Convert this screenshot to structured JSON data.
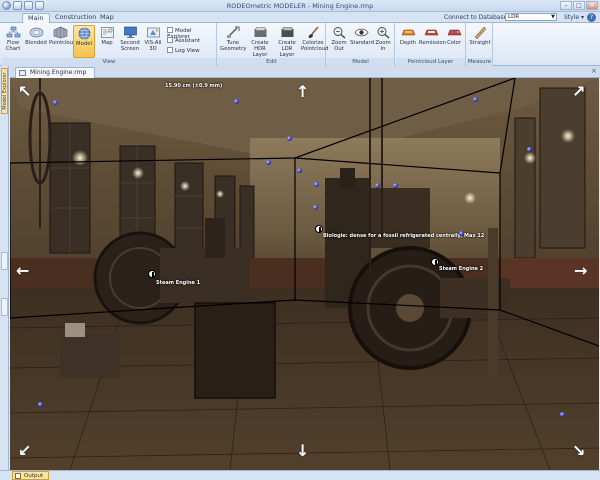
{
  "app": {
    "title": "RODEOmetric MODELER - Mining Engine.rmp"
  },
  "window": {
    "minimize": "–",
    "maximize": "□",
    "close": "✕"
  },
  "ribbon_tabs": [
    "Main",
    "Construction",
    "Map"
  ],
  "top_right": {
    "connect": "Connect to Database...",
    "select_value": "LDR",
    "style": "Style ▾",
    "help": "?"
  },
  "ribbon": {
    "view": {
      "caption": "View",
      "buttons": [
        {
          "label": "Flow\nChart",
          "icon": "flow-chart-icon"
        },
        {
          "label": "Blended",
          "icon": "blended-icon"
        },
        {
          "label": "Pointcloud",
          "icon": "pointcloud-icon"
        },
        {
          "label": "Model",
          "icon": "globe-icon",
          "active": true
        },
        {
          "label": "Map",
          "icon": "map-icon"
        },
        {
          "label": "Second\nScreen",
          "icon": "monitor-icon"
        },
        {
          "label": "VIS-All\n3D",
          "icon": "vis-3d-icon"
        }
      ],
      "checkboxes": [
        "Model Explorer",
        "Assistant",
        "Log View"
      ]
    },
    "edit": {
      "caption": "Edit",
      "buttons": [
        {
          "label": "Tune\nGeometry",
          "icon": "tune-geometry-icon"
        },
        {
          "label": "Create\nHDR Layer",
          "icon": "hdr-layer-icon"
        },
        {
          "label": "Create\nLDR Layer",
          "icon": "ldr-layer-icon"
        },
        {
          "label": "Colorize\nPointcloud",
          "icon": "brush-icon"
        }
      ]
    },
    "model": {
      "caption": "Model",
      "buttons": [
        {
          "label": "Zoom\nOut",
          "icon": "zoom-out-icon"
        },
        {
          "label": "Standard",
          "icon": "eye-icon"
        },
        {
          "label": "Zoom\nIn",
          "icon": "zoom-in-icon"
        }
      ]
    },
    "pointcloud_layer": {
      "caption": "Pointcloud Layer",
      "buttons": [
        {
          "label": "Depth",
          "icon": "depth-icon"
        },
        {
          "label": "Remission",
          "icon": "remission-icon"
        },
        {
          "label": "Color",
          "icon": "color-icon"
        }
      ]
    },
    "measure": {
      "caption": "Measure",
      "buttons": [
        {
          "label": "Straight",
          "icon": "ruler-icon"
        }
      ]
    }
  },
  "left_panel": {
    "tab_label": "Model Explorer"
  },
  "document": {
    "tab_label": "Mining Engine.rmp",
    "close": "×"
  },
  "scene": {
    "measurement_label": "15.90 cm (±0.9 mm)",
    "labels": [
      "Steam Engine 1",
      "Steam Engine 2",
      "Biologie: dense for a fossil refrigerated centrally, Max 12"
    ],
    "nav_arrows": [
      "↖",
      "↑",
      "↗",
      "←",
      "→",
      "↙",
      "↓",
      "↘"
    ]
  },
  "status": {
    "output_tab": "Output"
  }
}
